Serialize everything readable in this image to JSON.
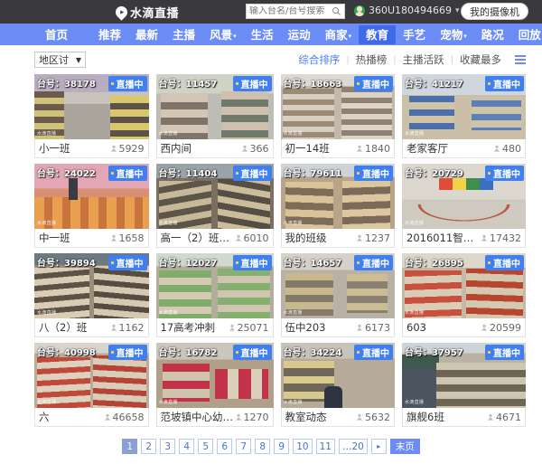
{
  "header": {
    "logo_text": "水滴直播",
    "logo_icon": "water-drop-play-icon",
    "search_placeholder": "输入台名/台号搜索",
    "search_value": "",
    "search_icon": "search-icon",
    "account_name": "360U180494669",
    "account_caret": "▾",
    "my_camera_label": "我的摄像机"
  },
  "nav": {
    "items": [
      {
        "label": "首页",
        "caret": "",
        "active": false
      },
      {
        "label": "推荐",
        "caret": "",
        "active": false
      },
      {
        "label": "最新",
        "caret": "",
        "active": false
      },
      {
        "label": "主播",
        "caret": "",
        "active": false
      },
      {
        "label": "风景",
        "caret": "▾",
        "active": false
      },
      {
        "label": "生活",
        "caret": "",
        "active": false
      },
      {
        "label": "运动",
        "caret": "",
        "active": false
      },
      {
        "label": "商家",
        "caret": "▾",
        "active": false
      },
      {
        "label": "教育",
        "caret": "",
        "active": true
      },
      {
        "label": "手艺",
        "caret": "",
        "active": false
      },
      {
        "label": "宠物",
        "caret": "▾",
        "active": false
      },
      {
        "label": "路况",
        "caret": "",
        "active": false
      },
      {
        "label": "回放",
        "caret": "",
        "active": false
      }
    ]
  },
  "toolbar": {
    "region_label": "地区讨",
    "region_caret": "▼",
    "sorts": [
      {
        "label": "综合排序",
        "active": true
      },
      {
        "label": "热播榜",
        "active": false
      },
      {
        "label": "主播活跃",
        "active": false
      },
      {
        "label": "收藏最多",
        "active": false
      }
    ],
    "separator": "|",
    "list_view_icon": "list-view-icon"
  },
  "cards": [
    {
      "id_label": "台号：38178",
      "live_label": "直播中",
      "title": "小一班",
      "views": "5929",
      "watermark": "水滴直播",
      "thumb": "t1"
    },
    {
      "id_label": "台号：11457",
      "live_label": "直播中",
      "title": "西内间",
      "views": "366",
      "watermark": "水滴直播",
      "thumb": "t2"
    },
    {
      "id_label": "台号：18663",
      "live_label": "直播中",
      "title": "初一14班",
      "views": "1840",
      "watermark": "水滴直播",
      "thumb": "t3"
    },
    {
      "id_label": "台号：41217",
      "live_label": "直播中",
      "title": "老家客厅",
      "views": "480",
      "watermark": "水滴直播",
      "thumb": "t4"
    },
    {
      "id_label": "台号：24022",
      "live_label": "直播中",
      "title": "中一班",
      "views": "1658",
      "watermark": "水滴直播",
      "thumb": "t5"
    },
    {
      "id_label": "台号：11404",
      "live_label": "直播中",
      "title": "高一（2）班青...",
      "views": "6010",
      "watermark": "水滴直播",
      "thumb": "t6"
    },
    {
      "id_label": "台号：79611",
      "live_label": "直播中",
      "title": "我的班级",
      "views": "1237",
      "watermark": "水滴直播",
      "thumb": "t7"
    },
    {
      "id_label": "台号：20729",
      "live_label": "直播中",
      "title": "2016011智芸五",
      "views": "17432",
      "watermark": "水滴直播",
      "thumb": "t8"
    },
    {
      "id_label": "台号：39894",
      "live_label": "直播中",
      "title": "八（2）班",
      "views": "1162",
      "watermark": "水滴直播",
      "thumb": "t9"
    },
    {
      "id_label": "台号：12027",
      "live_label": "直播中",
      "title": "17高考冲刺",
      "views": "25071",
      "watermark": "水滴直播",
      "thumb": "t10"
    },
    {
      "id_label": "台号：14657",
      "live_label": "直播中",
      "title": "伍中203",
      "views": "6173",
      "watermark": "水滴直播",
      "thumb": "t11"
    },
    {
      "id_label": "台号：26895",
      "live_label": "直播中",
      "title": "603",
      "views": "20599",
      "watermark": "水滴直播",
      "thumb": "t12"
    },
    {
      "id_label": "台号：40998",
      "live_label": "直播中",
      "title": "六",
      "views": "46658",
      "watermark": "水滴直播",
      "thumb": "t13"
    },
    {
      "id_label": "台号：16782",
      "live_label": "直播中",
      "title": "范坡镇中心幼儿...",
      "views": "1270",
      "watermark": "水滴直播",
      "thumb": "t14"
    },
    {
      "id_label": "台号：34224",
      "live_label": "直播中",
      "title": "教室动态",
      "views": "5632",
      "watermark": "水滴直播",
      "thumb": "t15"
    },
    {
      "id_label": "台号：37957",
      "live_label": "直播中",
      "title": "旗舰6班",
      "views": "4671",
      "watermark": "水滴直播",
      "thumb": "t16"
    }
  ],
  "pagination": {
    "pages": [
      {
        "label": "1",
        "active": true,
        "kind": "num"
      },
      {
        "label": "2",
        "active": false,
        "kind": "num"
      },
      {
        "label": "3",
        "active": false,
        "kind": "num"
      },
      {
        "label": "4",
        "active": false,
        "kind": "num"
      },
      {
        "label": "5",
        "active": false,
        "kind": "num"
      },
      {
        "label": "6",
        "active": false,
        "kind": "num"
      },
      {
        "label": "7",
        "active": false,
        "kind": "num"
      },
      {
        "label": "8",
        "active": false,
        "kind": "num"
      },
      {
        "label": "9",
        "active": false,
        "kind": "num"
      },
      {
        "label": "10",
        "active": false,
        "kind": "num"
      },
      {
        "label": "11",
        "active": false,
        "kind": "num"
      },
      {
        "label": "…20",
        "active": false,
        "kind": "num"
      },
      {
        "label": "▸",
        "active": false,
        "kind": "arrow"
      },
      {
        "label": "末页",
        "active": false,
        "kind": "last"
      }
    ]
  },
  "colors": {
    "topbar_bg": "#3a3a3e",
    "nav_bg": "#6b8cf5",
    "nav_active_bg": "#3f6ae8",
    "accent": "#4b7bf5",
    "live_badge_bg": "#3f7ff0"
  }
}
